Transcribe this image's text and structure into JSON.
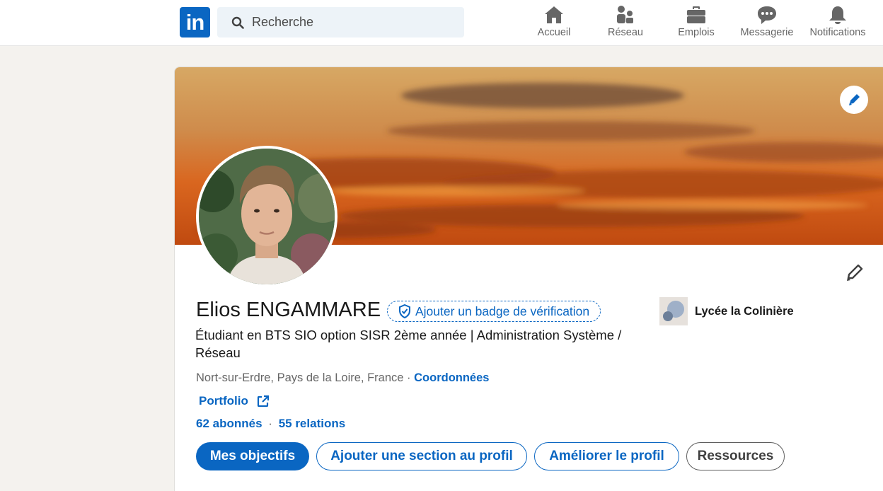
{
  "brand": {
    "logo_text": "in",
    "color": "#0a66c2"
  },
  "search": {
    "placeholder": "Recherche",
    "value": ""
  },
  "nav": {
    "items": [
      {
        "label": "Accueil",
        "icon": "home-icon"
      },
      {
        "label": "Réseau",
        "icon": "people-icon"
      },
      {
        "label": "Emplois",
        "icon": "briefcase-icon"
      },
      {
        "label": "Messagerie",
        "icon": "chat-icon"
      },
      {
        "label": "Notifications",
        "icon": "bell-icon"
      }
    ]
  },
  "profile": {
    "name": "Elios ENGAMMARE",
    "verify_badge": "Ajouter un badge de vérification",
    "headline": "Étudiant en BTS SIO option SISR 2ème année | Administration Système / Réseau",
    "location": "Nort-sur-Erdre, Pays de la Loire, France",
    "location_sep": " · ",
    "contact_label": "Coordonnées",
    "portfolio_label": "Portfolio",
    "followers": "62 abonnés",
    "network_sep": "·",
    "connections": "55 relations",
    "school": "Lycée la Colinière"
  },
  "actions": {
    "primary": "Mes objectifs",
    "add_section": "Ajouter une section au profil",
    "improve": "Améliorer le profil",
    "resources": "Ressources"
  },
  "colors": {
    "link": "#0a66c2",
    "background": "#f4f2ee",
    "text_secondary": "#666666"
  }
}
